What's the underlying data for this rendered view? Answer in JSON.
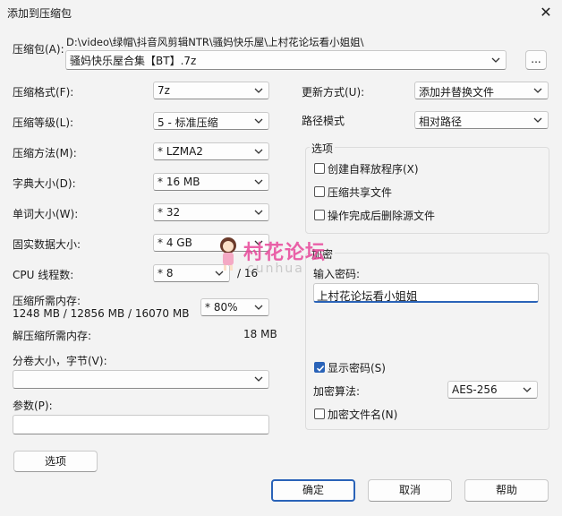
{
  "dialog": {
    "title": "添加到压缩包",
    "close_glyph": "✕"
  },
  "archive": {
    "label": "压缩包(A):",
    "path": "D:\\video\\绿帽\\抖音风剪辑NTR\\骚妈快乐屋\\上村花论坛看小姐姐\\",
    "name": "骚妈快乐屋合集【BT】.7z",
    "browse_label": "..."
  },
  "left": {
    "format": {
      "label": "压缩格式(F):",
      "value": "7z"
    },
    "level": {
      "label": "压缩等级(L):",
      "value": "5 - 标准压缩"
    },
    "method": {
      "label": "压缩方法(M):",
      "value": "* LZMA2"
    },
    "dict": {
      "label": "字典大小(D):",
      "value": "* 16 MB"
    },
    "word": {
      "label": "单词大小(W):",
      "value": "* 32"
    },
    "solid": {
      "label": "固实数据大小:",
      "value": "* 4 GB"
    },
    "threads": {
      "label": "CPU 线程数:",
      "value": "* 8",
      "max": "/ 16"
    },
    "mem": {
      "label": "压缩所需内存:",
      "detail": "1248 MB / 12856 MB / 16070 MB",
      "value": "* 80%"
    },
    "decomp": {
      "label": "解压缩所需内存:",
      "value": "18 MB"
    },
    "volume": {
      "label": "分卷大小，字节(V):",
      "value": ""
    },
    "params": {
      "label": "参数(P):",
      "value": ""
    },
    "options_button": "选项"
  },
  "right": {
    "update": {
      "label": "更新方式(U):",
      "value": "添加并替换文件"
    },
    "pathmode": {
      "label": "路径模式",
      "value": "相对路径"
    },
    "options_group": {
      "title": "选项",
      "sfx": "创建自释放程序(X)",
      "shared": "压缩共享文件",
      "delete": "操作完成后删除源文件"
    },
    "encrypt_group": {
      "title": "加密",
      "pw_label": "输入密码:",
      "pw_value": "上村花论坛看小姐姐",
      "show_pw": "显示密码(S)",
      "method_label": "加密算法:",
      "method_value": "AES-256",
      "encrypt_names": "加密文件名(N)"
    }
  },
  "footer": {
    "ok": "确定",
    "cancel": "取消",
    "help": "帮助"
  },
  "watermark": {
    "text": "村花论坛",
    "sub": "cunhua"
  },
  "colors": {
    "accent": "#2a63b8",
    "watermark": "#e8479a"
  }
}
